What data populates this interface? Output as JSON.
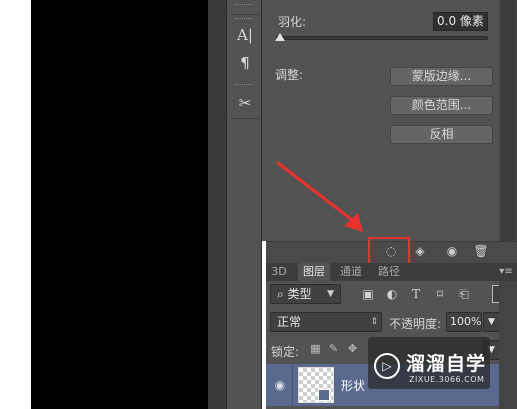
{
  "toolstrip": {
    "tools": [
      {
        "name": "character-icon",
        "glyph": "A|"
      },
      {
        "name": "paragraph-icon",
        "glyph": "¶"
      },
      {
        "name": "tool-presets-icon",
        "glyph": "✂"
      }
    ]
  },
  "properties": {
    "feather_label": "羽化:",
    "feather_value": "0.0 像素",
    "feather_level": 0,
    "adjust_label": "调整:",
    "buttons": {
      "mask_edge": "蒙版边缘...",
      "color_range": "颜色范围...",
      "invert": "反相"
    },
    "footer_icons": [
      "load-selection-icon",
      "apply-mask-icon",
      "visibility-icon",
      "delete-icon"
    ]
  },
  "layers_panel": {
    "tabs": [
      "3D",
      "图层",
      "通道",
      "路径"
    ],
    "active_tab": "图层",
    "filter_kind": "类型",
    "blend_mode": "正常",
    "opacity_label": "不透明度:",
    "opacity_value": "100%",
    "lock_label": "锁定:",
    "layer_name": "形状"
  },
  "watermark": {
    "title": "溜溜自学",
    "url": "ZIXUE.3066.COM"
  },
  "colors": {
    "highlight": "#e8322d",
    "arrow": "#e8322d",
    "selected_layer": "#596a8e"
  }
}
